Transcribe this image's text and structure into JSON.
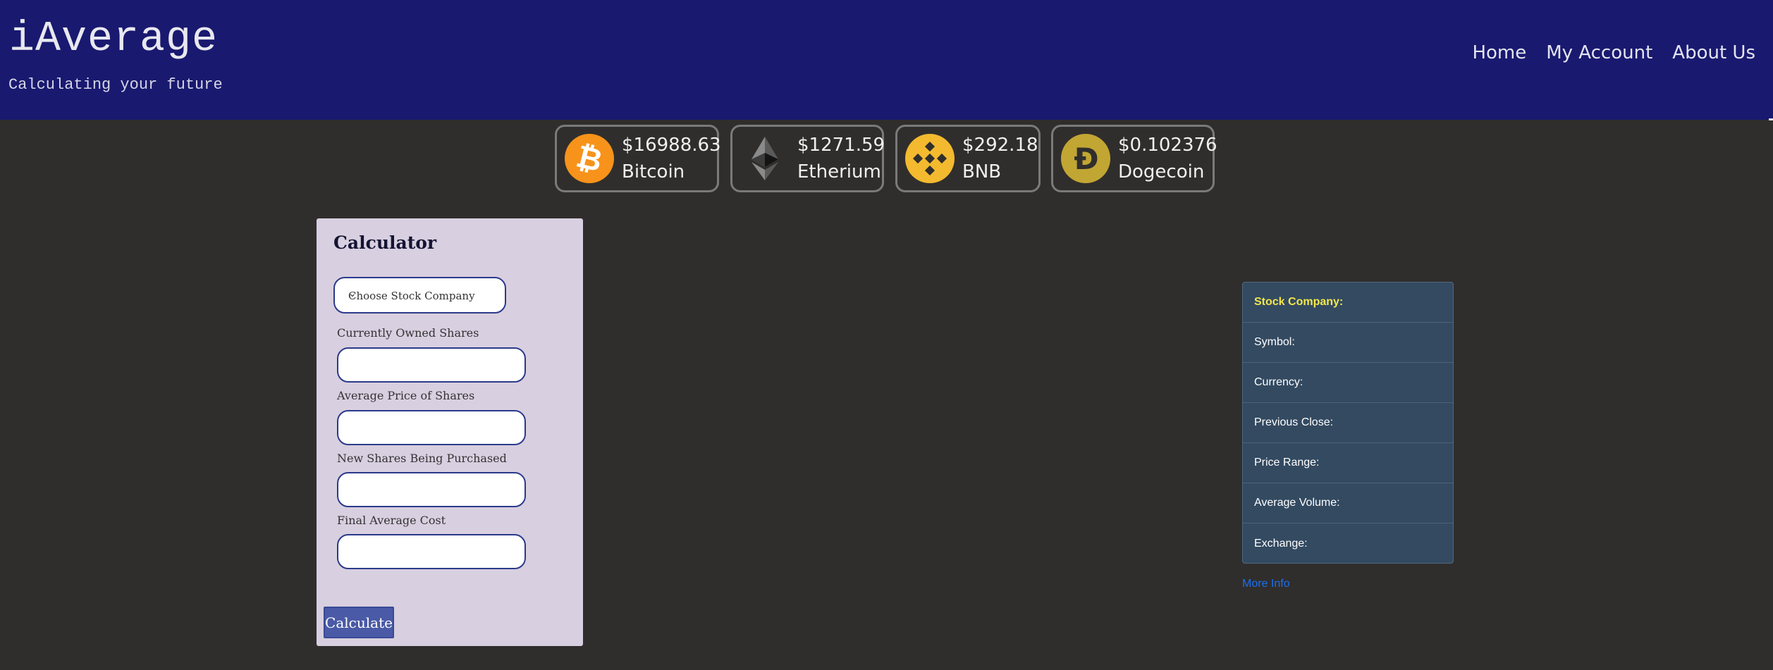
{
  "header": {
    "title": "iAverage",
    "subtitle": "Calculating your future",
    "nav": [
      "Home",
      "My Account",
      "About Us"
    ]
  },
  "ticker": [
    {
      "price": "$16988.63",
      "name": "Bitcoin",
      "icon": "bitcoin-icon",
      "color": "#f7931a"
    },
    {
      "price": "$1271.59",
      "name": "Etherium",
      "icon": "ethereum-icon",
      "color": "#3c3c3d"
    },
    {
      "price": "$292.18",
      "name": "BNB",
      "icon": "bnb-icon",
      "color": "#f3ba2f"
    },
    {
      "price": "$0.102376",
      "name": "Dogecoin",
      "icon": "dogecoin-icon",
      "color": "#c2a633"
    }
  ],
  "calculator": {
    "title": "Calculator",
    "select_placeholder": "Choose Stock Company",
    "fields": [
      {
        "label": "Currently Owned Shares",
        "value": ""
      },
      {
        "label": "Average Price of Shares",
        "value": ""
      },
      {
        "label": "New Shares Being Purchased",
        "value": ""
      },
      {
        "label": "Final Average Cost",
        "value": ""
      }
    ],
    "button": "Calculate"
  },
  "info": {
    "rows": [
      "Stock Company:",
      "Symbol:",
      "Currency:",
      "Previous Close:",
      "Price Range:",
      "Average Volume:",
      "Exchange:"
    ],
    "link": "More Info"
  },
  "colors": {
    "header_bg": "#191970",
    "page_bg": "#302e2c",
    "calc_bg": "#d8cfe0",
    "info_bg": "#334a61",
    "highlight": "#f3e64a",
    "link": "#1a6ff0"
  }
}
